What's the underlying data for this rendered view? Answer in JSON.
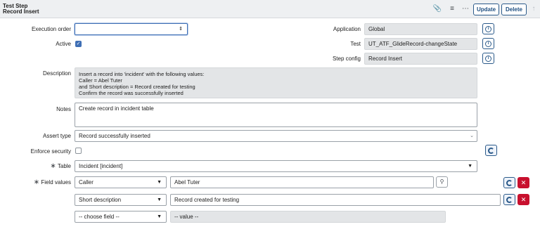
{
  "header": {
    "title_line1": "Test Step",
    "title_line2": "Record Insert",
    "update_label": "Update",
    "delete_label": "Delete",
    "icons": [
      "paperclip-icon",
      "settings-sliders-icon",
      "more-options-icon",
      "arrow-up-icon"
    ]
  },
  "form": {
    "execution_order": {
      "label": "Execution order",
      "value": ""
    },
    "active": {
      "label": "Active",
      "checked": true
    },
    "application": {
      "label": "Application",
      "value": "Global"
    },
    "test": {
      "label": "Test",
      "value": "UT_ATF_GlideRecord-changeState"
    },
    "step_config": {
      "label": "Step config",
      "value": "Record Insert"
    },
    "description": {
      "label": "Description",
      "lines": [
        "Insert a record into 'incident' with the following values:",
        "Caller = Abel Tuter",
        "and Short description = Record created for testing",
        "Confirm the record was successfully inserted"
      ]
    },
    "notes": {
      "label": "Notes",
      "value": "Create record in incident table"
    },
    "assert_type": {
      "label": "Assert type",
      "value": "Record successfully inserted"
    },
    "enforce_security": {
      "label": "Enforce security",
      "checked": false
    },
    "table": {
      "label": "Table",
      "value": "Incident [incident]"
    },
    "field_values": {
      "label": "Field values",
      "rows": [
        {
          "field": "Caller",
          "value": "Abel Tuter"
        },
        {
          "field": "Short description",
          "value": "Record created for testing"
        },
        {
          "field": "-- choose field --",
          "value": "-- value --"
        }
      ]
    }
  },
  "colors": {
    "accent": "#2b5a8a",
    "danger": "#c8102e",
    "readonly_bg": "#e3e5e7",
    "header_bg": "#eef0f2"
  }
}
